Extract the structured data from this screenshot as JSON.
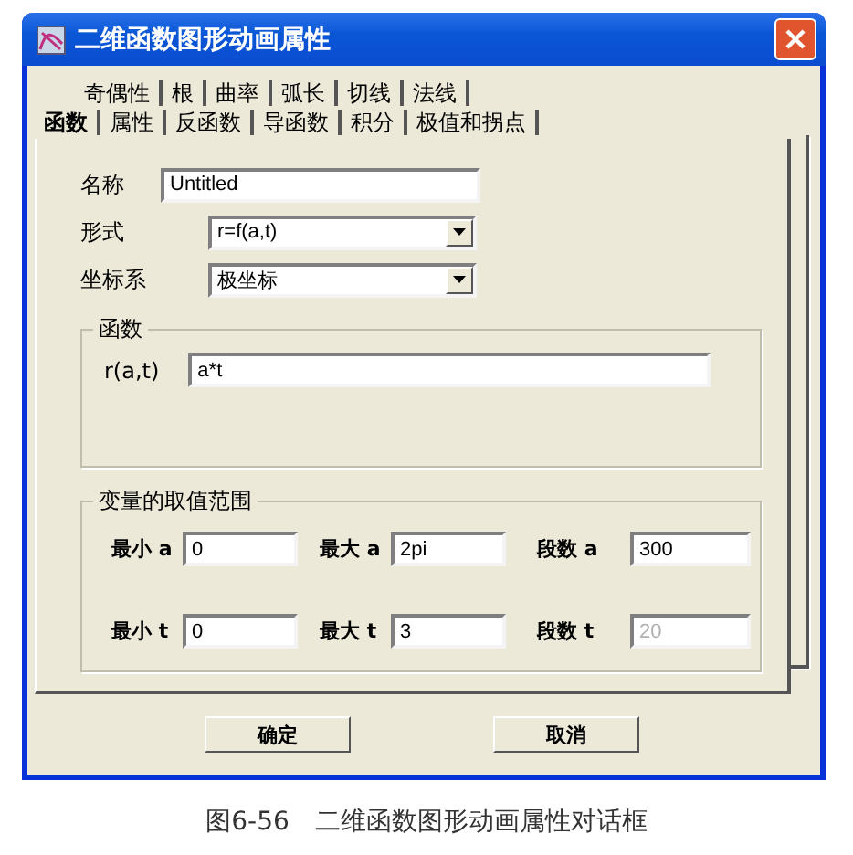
{
  "window": {
    "title": "二维函数图形动画属性"
  },
  "tab_rows": [
    {
      "tabs": [
        {
          "label": "奇偶性",
          "selected": false
        },
        {
          "label": "根",
          "selected": false
        },
        {
          "label": "曲率",
          "selected": false
        },
        {
          "label": "弧长",
          "selected": false
        },
        {
          "label": "切线",
          "selected": false
        },
        {
          "label": "法线",
          "selected": false
        }
      ]
    },
    {
      "tabs": [
        {
          "label": "函数",
          "selected": true
        },
        {
          "label": "属性",
          "selected": false
        },
        {
          "label": "反函数",
          "selected": false
        },
        {
          "label": "导函数",
          "selected": false
        },
        {
          "label": "积分",
          "selected": false
        },
        {
          "label": "极值和拐点",
          "selected": false
        }
      ]
    }
  ],
  "fields": [
    {
      "kind": "text",
      "label": "名称",
      "value": "Untitled"
    },
    {
      "kind": "dropdown",
      "label": "形式",
      "value": "r=f(a,t)"
    },
    {
      "kind": "dropdown",
      "label": "坐标系",
      "value": "极坐标"
    }
  ],
  "function_group": {
    "title": "函数",
    "label": "r(a,t)",
    "value": "a*t"
  },
  "range_group": {
    "title": "变量的取值范围",
    "rows": [
      {
        "fields": [
          {
            "label": "最小 a",
            "value": "0",
            "disabled": false
          },
          {
            "label": "最大 a",
            "value": "2pi",
            "disabled": false
          },
          {
            "label": "段数 a",
            "value": "300",
            "disabled": false
          }
        ]
      },
      {
        "fields": [
          {
            "label": "最小 t",
            "value": "0",
            "disabled": false
          },
          {
            "label": "最大 t",
            "value": "3",
            "disabled": false
          },
          {
            "label": "段数 t",
            "value": "20",
            "disabled": true
          }
        ]
      }
    ]
  },
  "buttons": [
    "确定",
    "取消"
  ],
  "caption": "图6-56　二维函数图形动画属性对话框"
}
